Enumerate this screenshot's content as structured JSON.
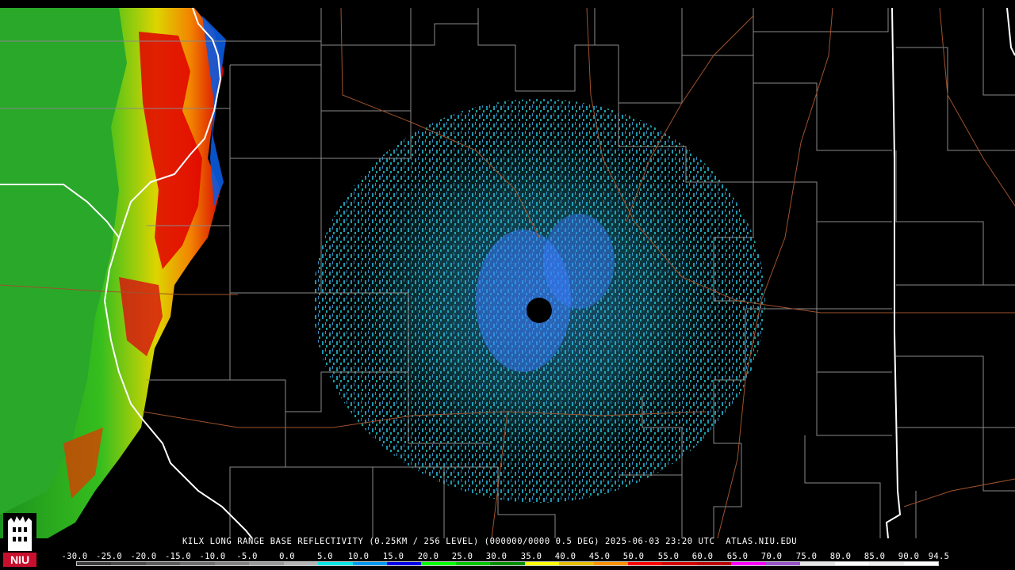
{
  "caption": "KILX LONG RANGE BASE REFLECTIVITY (0.25KM / 256 LEVEL) (000000/0000 0.5 DEG) 2025-06-03 23:20 UTC  ATLAS.NIU.EDU",
  "scale": {
    "labels": [
      "-30.0",
      "-25.0",
      "-20.0",
      "-15.0",
      "-10.0",
      "-5.0",
      "0.0",
      "5.0",
      "10.0",
      "15.0",
      "20.0",
      "25.0",
      "30.0",
      "35.0",
      "40.0",
      "45.0",
      "50.0",
      "55.0",
      "60.0",
      "65.0",
      "70.0",
      "75.0",
      "80.0",
      "85.0",
      "90.0",
      "94.5"
    ],
    "colors": [
      "#3b3b3b",
      "#4a4a4a",
      "#5c5c5c",
      "#6e6e6e",
      "#828282",
      "#999999",
      "#b4b4b4",
      "#00e7e7",
      "#0099f0",
      "#0000e8",
      "#00ff00",
      "#00c800",
      "#008f00",
      "#ffff00",
      "#e6bf00",
      "#ff9200",
      "#ff0000",
      "#d50000",
      "#bb0000",
      "#ff00ff",
      "#9955c9",
      "#e6e6e6",
      "#ffffff",
      "#f0f0f0",
      "#ffffff"
    ]
  },
  "logo": {
    "text": "NIU",
    "bg": "#c8102e"
  },
  "colors": {
    "county_line": "#8a8a8a",
    "state_line": "#ffffff",
    "highway": "#a0522d",
    "background": "#000000"
  }
}
